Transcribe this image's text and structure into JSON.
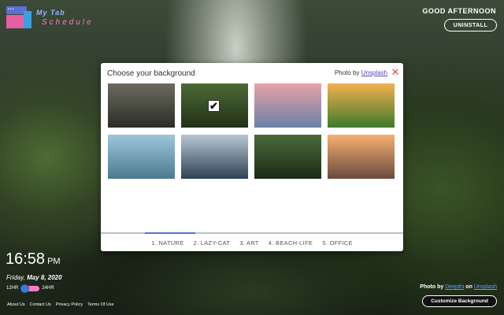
{
  "logo": {
    "line1": "My Tab",
    "line2": "Schedule",
    "dots": "•••"
  },
  "header": {
    "greeting": "GOOD AFTERNOON",
    "uninstall_label": "UNINSTALL"
  },
  "modal": {
    "title": "Choose your background",
    "credit_prefix": "Photo by",
    "credit_link": "Unsplash",
    "close_icon": "close-icon",
    "selected_index": 1,
    "thumbnails": [
      {
        "name": "river-gorge",
        "colors": [
          "#6d6a60",
          "#2a2e28"
        ]
      },
      {
        "name": "forest-waterfall",
        "colors": [
          "#4d6a35",
          "#223018"
        ]
      },
      {
        "name": "mountain-road-dusk",
        "colors": [
          "#e7a3a8",
          "#6a7fa8"
        ]
      },
      {
        "name": "poppy-field-sunset",
        "colors": [
          "#f2b050",
          "#3e7a2a"
        ]
      },
      {
        "name": "palm-aerial-beach",
        "colors": [
          "#9ec6dc",
          "#4b7a8e"
        ]
      },
      {
        "name": "mountain-lake",
        "colors": [
          "#b7c6d4",
          "#2d4254"
        ]
      },
      {
        "name": "tree-reflection-lake",
        "colors": [
          "#4a6a3a",
          "#1d2a16"
        ]
      },
      {
        "name": "foggy-sunset-hills",
        "colors": [
          "#f6b070",
          "#6a4a3e"
        ]
      }
    ],
    "tabs": [
      "1. NATURE",
      "2. LAZY-CAT",
      "3. ART",
      "4. BEACH-LIFE",
      "5. OFFICE"
    ],
    "active_tab": 0
  },
  "clock": {
    "time": "16:58",
    "ampm": "PM",
    "weekday": "Friday,",
    "date": "May 8, 2020"
  },
  "time_format": {
    "left": "12HR",
    "right": "24HR",
    "value": "12HR"
  },
  "footer": {
    "links": [
      "About Us",
      "Contact Us",
      "Privacy Policy",
      "Terms Of Use"
    ]
  },
  "photo_credit": {
    "prefix": "Photo by",
    "author": "Deepthi",
    "on": "on",
    "source": "Unsplash"
  },
  "customize_label": "Customize Background"
}
